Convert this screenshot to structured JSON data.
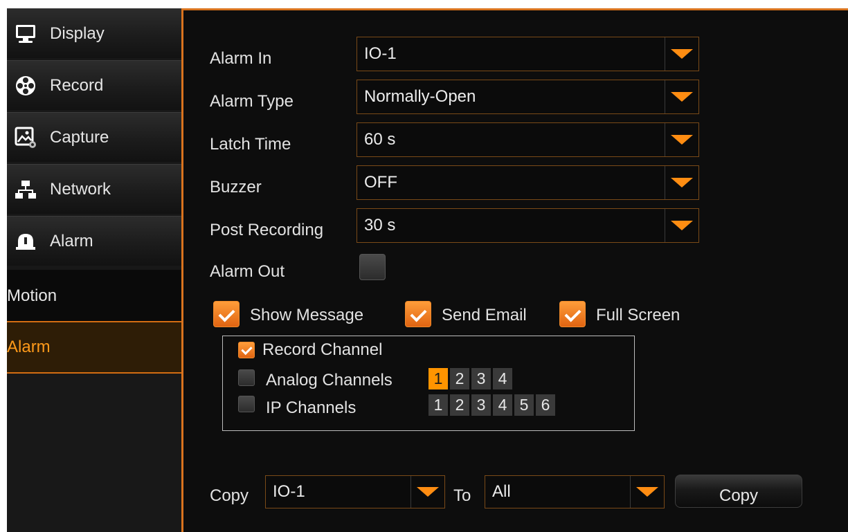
{
  "sidebar": {
    "items": [
      {
        "label": "Display",
        "icon": "monitor-icon"
      },
      {
        "label": "Record",
        "icon": "film-reel-icon"
      },
      {
        "label": "Capture",
        "icon": "image-capture-icon"
      },
      {
        "label": "Network",
        "icon": "network-icon"
      },
      {
        "label": "Alarm",
        "icon": "alarm-bell-icon"
      }
    ],
    "sub_items": [
      {
        "label": "Motion",
        "active": false
      },
      {
        "label": "Alarm",
        "active": true
      }
    ]
  },
  "form": {
    "alarm_in": {
      "label": "Alarm In",
      "value": "IO-1"
    },
    "alarm_type": {
      "label": "Alarm Type",
      "value": "Normally-Open"
    },
    "latch_time": {
      "label": "Latch Time",
      "value": "60 s"
    },
    "buzzer": {
      "label": "Buzzer",
      "value": "OFF"
    },
    "post_recording": {
      "label": "Post Recording",
      "value": "30 s"
    },
    "alarm_out": {
      "label": "Alarm Out",
      "checked": false
    },
    "show_message": {
      "label": "Show Message",
      "checked": true
    },
    "send_email": {
      "label": "Send Email",
      "checked": true
    },
    "full_screen": {
      "label": "Full Screen",
      "checked": true
    }
  },
  "record_channel": {
    "label": "Record Channel",
    "checked": true,
    "analog": {
      "label": "Analog Channels",
      "checked": false,
      "channels": [
        "1",
        "2",
        "3",
        "4"
      ],
      "selected": [
        "1"
      ]
    },
    "ip": {
      "label": "IP Channels",
      "checked": false,
      "channels": [
        "1",
        "2",
        "3",
        "4",
        "5",
        "6"
      ],
      "selected": []
    }
  },
  "copy": {
    "label": "Copy",
    "from_value": "IO-1",
    "to_label": "To",
    "to_value": "All",
    "button_label": "Copy"
  },
  "colors": {
    "accent": "#ff8d12",
    "active_sub_bg": "#2e1d06",
    "panel_bg": "#0d0d0d"
  }
}
